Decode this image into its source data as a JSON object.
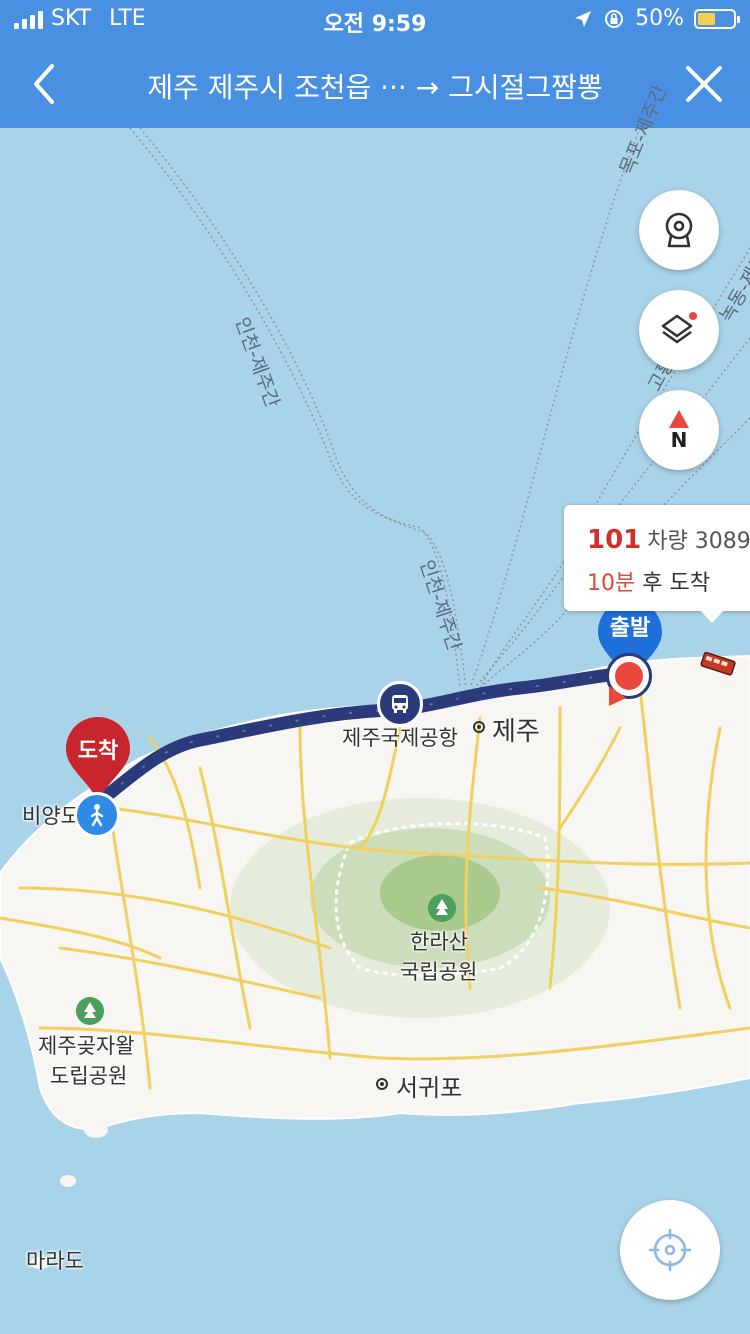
{
  "status_bar": {
    "carrier": "SKT",
    "network": "LTE",
    "time": "오전 9:59",
    "battery": "50%",
    "battery_level": 0.5
  },
  "nav": {
    "title": "제주 제주시 조천읍 ··· → 그시절그짬뽕",
    "back_icon": "chevron-left-icon",
    "close_icon": "close-icon"
  },
  "map": {
    "route_labels": [
      "인천-제주간",
      "인천-제주간",
      "목포-제주간",
      "고흥-제주간",
      "녹동-제주간"
    ],
    "places": {
      "airport": "제주국제공항",
      "jeju": "제주",
      "hallasan": [
        "한라산",
        "국립공원"
      ],
      "gotjawal": [
        "제주곶자왈",
        "도립공원"
      ],
      "seogwipo": "서귀포",
      "marado": "마라도",
      "biyangdo": "비양도"
    },
    "start_pin_label": "출발",
    "end_pin_label": "도착"
  },
  "bus_callout": {
    "route_number": "101",
    "vehicle_label": "차량 3089",
    "eta_minutes": "10분",
    "eta_suffix": "후 도착"
  },
  "buttons": {
    "cctv_icon": "cctv-icon",
    "layers_icon": "layers-icon",
    "compass_icon": "compass-icon",
    "compass_letter": "N",
    "locate_icon": "crosshair-icon"
  },
  "colors": {
    "header": "#4a90e2",
    "route": "#2b3a7a",
    "start_pin": "#1e6fd9",
    "end_pin": "#c9252c",
    "sea": "#a9d3e9",
    "road": "#f2d060"
  }
}
